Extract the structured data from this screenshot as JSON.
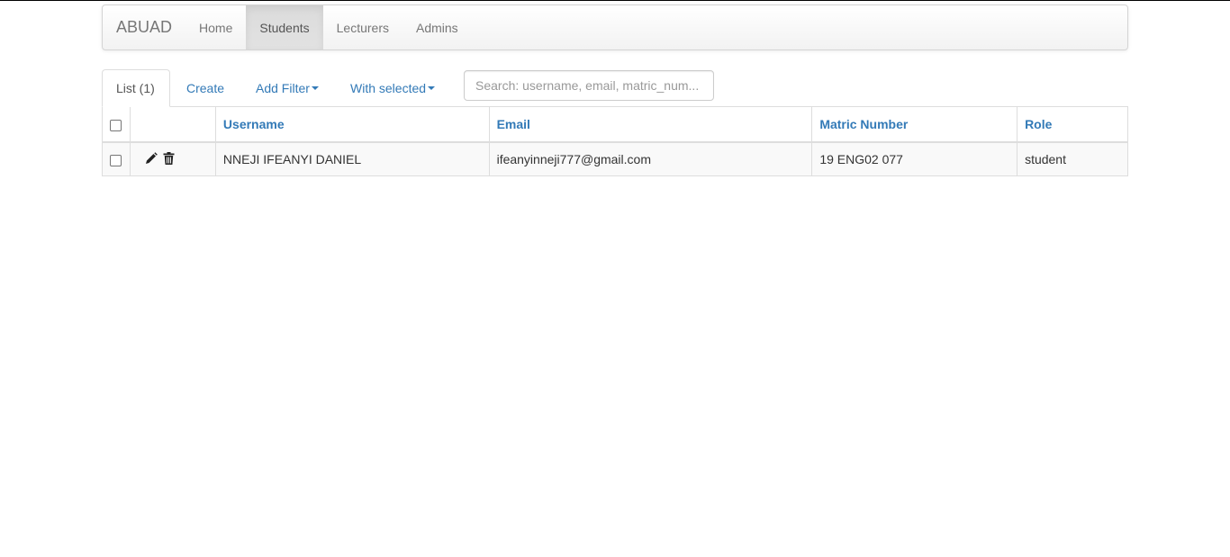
{
  "navbar": {
    "brand": "ABUAD",
    "items": [
      {
        "label": "Home",
        "active": false
      },
      {
        "label": "Students",
        "active": true
      },
      {
        "label": "Lecturers",
        "active": false
      },
      {
        "label": "Admins",
        "active": false
      }
    ]
  },
  "tabs": {
    "list": "List (1)",
    "create": "Create",
    "add_filter": "Add Filter",
    "with_selected": "With selected"
  },
  "search": {
    "placeholder": "Search: username, email, matric_num..."
  },
  "table": {
    "columns": [
      "Username",
      "Email",
      "Matric Number",
      "Role"
    ],
    "rows": [
      {
        "username": "NNEJI IFEANYI DANIEL",
        "email": "ifeanyinneji777@gmail.com",
        "matric_number": "19 ENG02 077",
        "role": "student"
      }
    ]
  },
  "icons": {
    "edit": "pencil-icon",
    "delete": "trash-icon"
  },
  "colors": {
    "link": "#337ab7",
    "nav_text": "#777777",
    "border": "#dddddd"
  }
}
